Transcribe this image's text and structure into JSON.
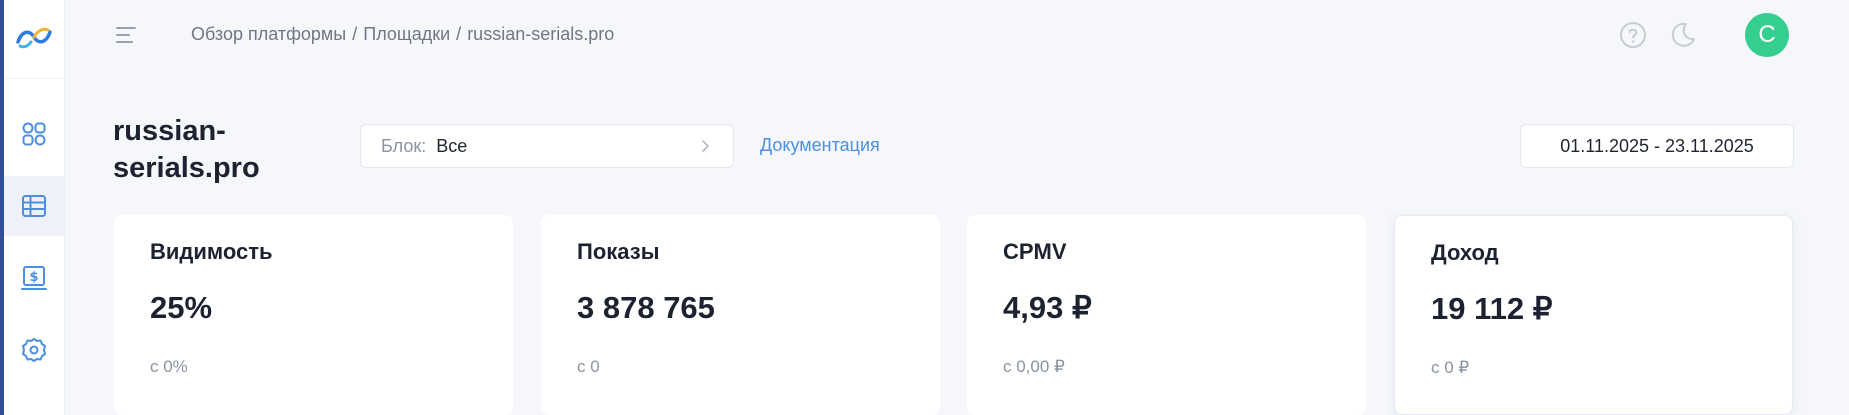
{
  "header": {
    "breadcrumb": [
      {
        "label": "Обзор платформы"
      },
      {
        "label": "Площадки"
      },
      {
        "label": "russian-serials.pro"
      }
    ],
    "separator": "/",
    "avatar_letter": "C"
  },
  "sidebar": {
    "items": [
      {
        "icon": "dashboard-icon"
      },
      {
        "icon": "table-icon",
        "active": true
      },
      {
        "icon": "payments-icon"
      },
      {
        "icon": "settings-icon"
      }
    ]
  },
  "page": {
    "title": "russian-serials.pro",
    "block_filter": {
      "label": "Блок:",
      "value": "Все"
    },
    "docs_link": "Документация",
    "date_range": "01.11.2025 - 23.11.2025"
  },
  "cards": [
    {
      "title": "Видимость",
      "value": "25%",
      "sub": "с 0%"
    },
    {
      "title": "Показы",
      "value": "3 878 765",
      "sub": "с 0"
    },
    {
      "title": "CPMV",
      "value": "4,93 ₽",
      "sub": "с 0,00 ₽"
    },
    {
      "title": "Доход",
      "value": "19 112 ₽",
      "sub": "с 0 ₽"
    }
  ],
  "colors": {
    "accent": "#4b8fe0",
    "avatar": "#34cf8e",
    "background": "#f5f7fb"
  }
}
